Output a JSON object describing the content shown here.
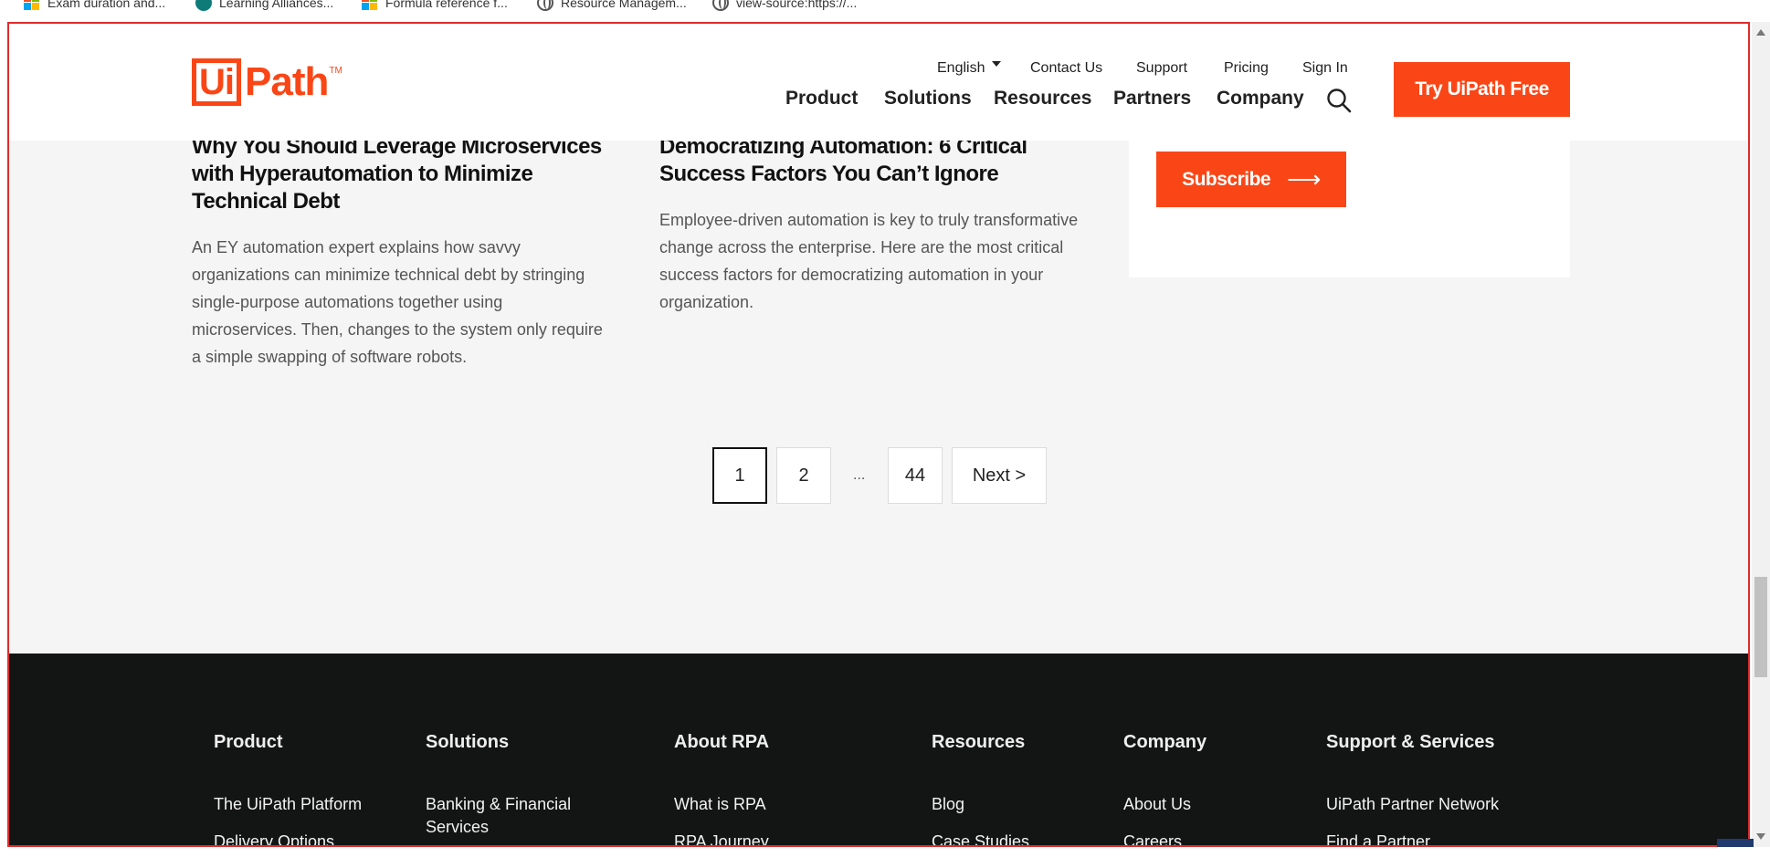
{
  "bookmarks": [
    {
      "label": "Exam duration and...",
      "icon": "microsoft-icon"
    },
    {
      "label": "Learning Alliances...",
      "icon": "sharepoint-icon"
    },
    {
      "label": "Formula reference f...",
      "icon": "microsoft-icon"
    },
    {
      "label": "Resource Managem...",
      "icon": "globe-icon"
    },
    {
      "label": "view-source:https://...",
      "icon": "globe-icon"
    }
  ],
  "header": {
    "logo_ui": "Ui",
    "logo_path": "Path",
    "logo_tm": "TM",
    "language": "English",
    "contact": "Contact Us",
    "support": "Support",
    "pricing": "Pricing",
    "signin": "Sign In",
    "nav": [
      "Product",
      "Solutions",
      "Resources",
      "Partners",
      "Company"
    ],
    "cta": "Try UiPath Free"
  },
  "articles": [
    {
      "title_lines": [
        "Why You Should Leverage Microservices",
        "with Hyperautomation to Minimize",
        "Technical Debt"
      ],
      "desc_lines": [
        "An EY automation expert explains how savvy",
        "organizations can minimize technical debt by stringing",
        "single-purpose automations together using",
        "microservices. Then, changes to the system only require",
        "a simple swapping of software robots."
      ]
    },
    {
      "title_lines": [
        "Democratizing Automation: 6 Critical",
        "Success Factors You Can’t Ignore"
      ],
      "desc_lines": [
        "Employee-driven automation is key to truly transformative",
        "change across the enterprise. Here are the most critical",
        "success factors for democratizing automation in your",
        "organization."
      ]
    }
  ],
  "subscribe": {
    "label": "Subscribe",
    "arrow": "⟶"
  },
  "pagination": {
    "pages": [
      "1",
      "2",
      "44"
    ],
    "ellipsis": "...",
    "next": "Next  >",
    "current": "1"
  },
  "footer": {
    "columns": [
      {
        "heading": "Product",
        "links": [
          "The UiPath Platform",
          "Delivery Options"
        ]
      },
      {
        "heading": "Solutions",
        "links": [
          "Banking & Financial",
          "Services"
        ]
      },
      {
        "heading": "About RPA",
        "links": [
          "What is RPA",
          "RPA Journey"
        ]
      },
      {
        "heading": "Resources",
        "links": [
          "Blog",
          "Case Studies"
        ]
      },
      {
        "heading": "Company",
        "links": [
          "About Us",
          "Careers"
        ]
      },
      {
        "heading": "Support & Services",
        "links": [
          "UiPath Partner Network",
          "Find a Partner"
        ]
      }
    ]
  },
  "colors": {
    "brand": "#fa4616",
    "footer_bg": "#131514",
    "page_bg": "#f5f5f5"
  }
}
